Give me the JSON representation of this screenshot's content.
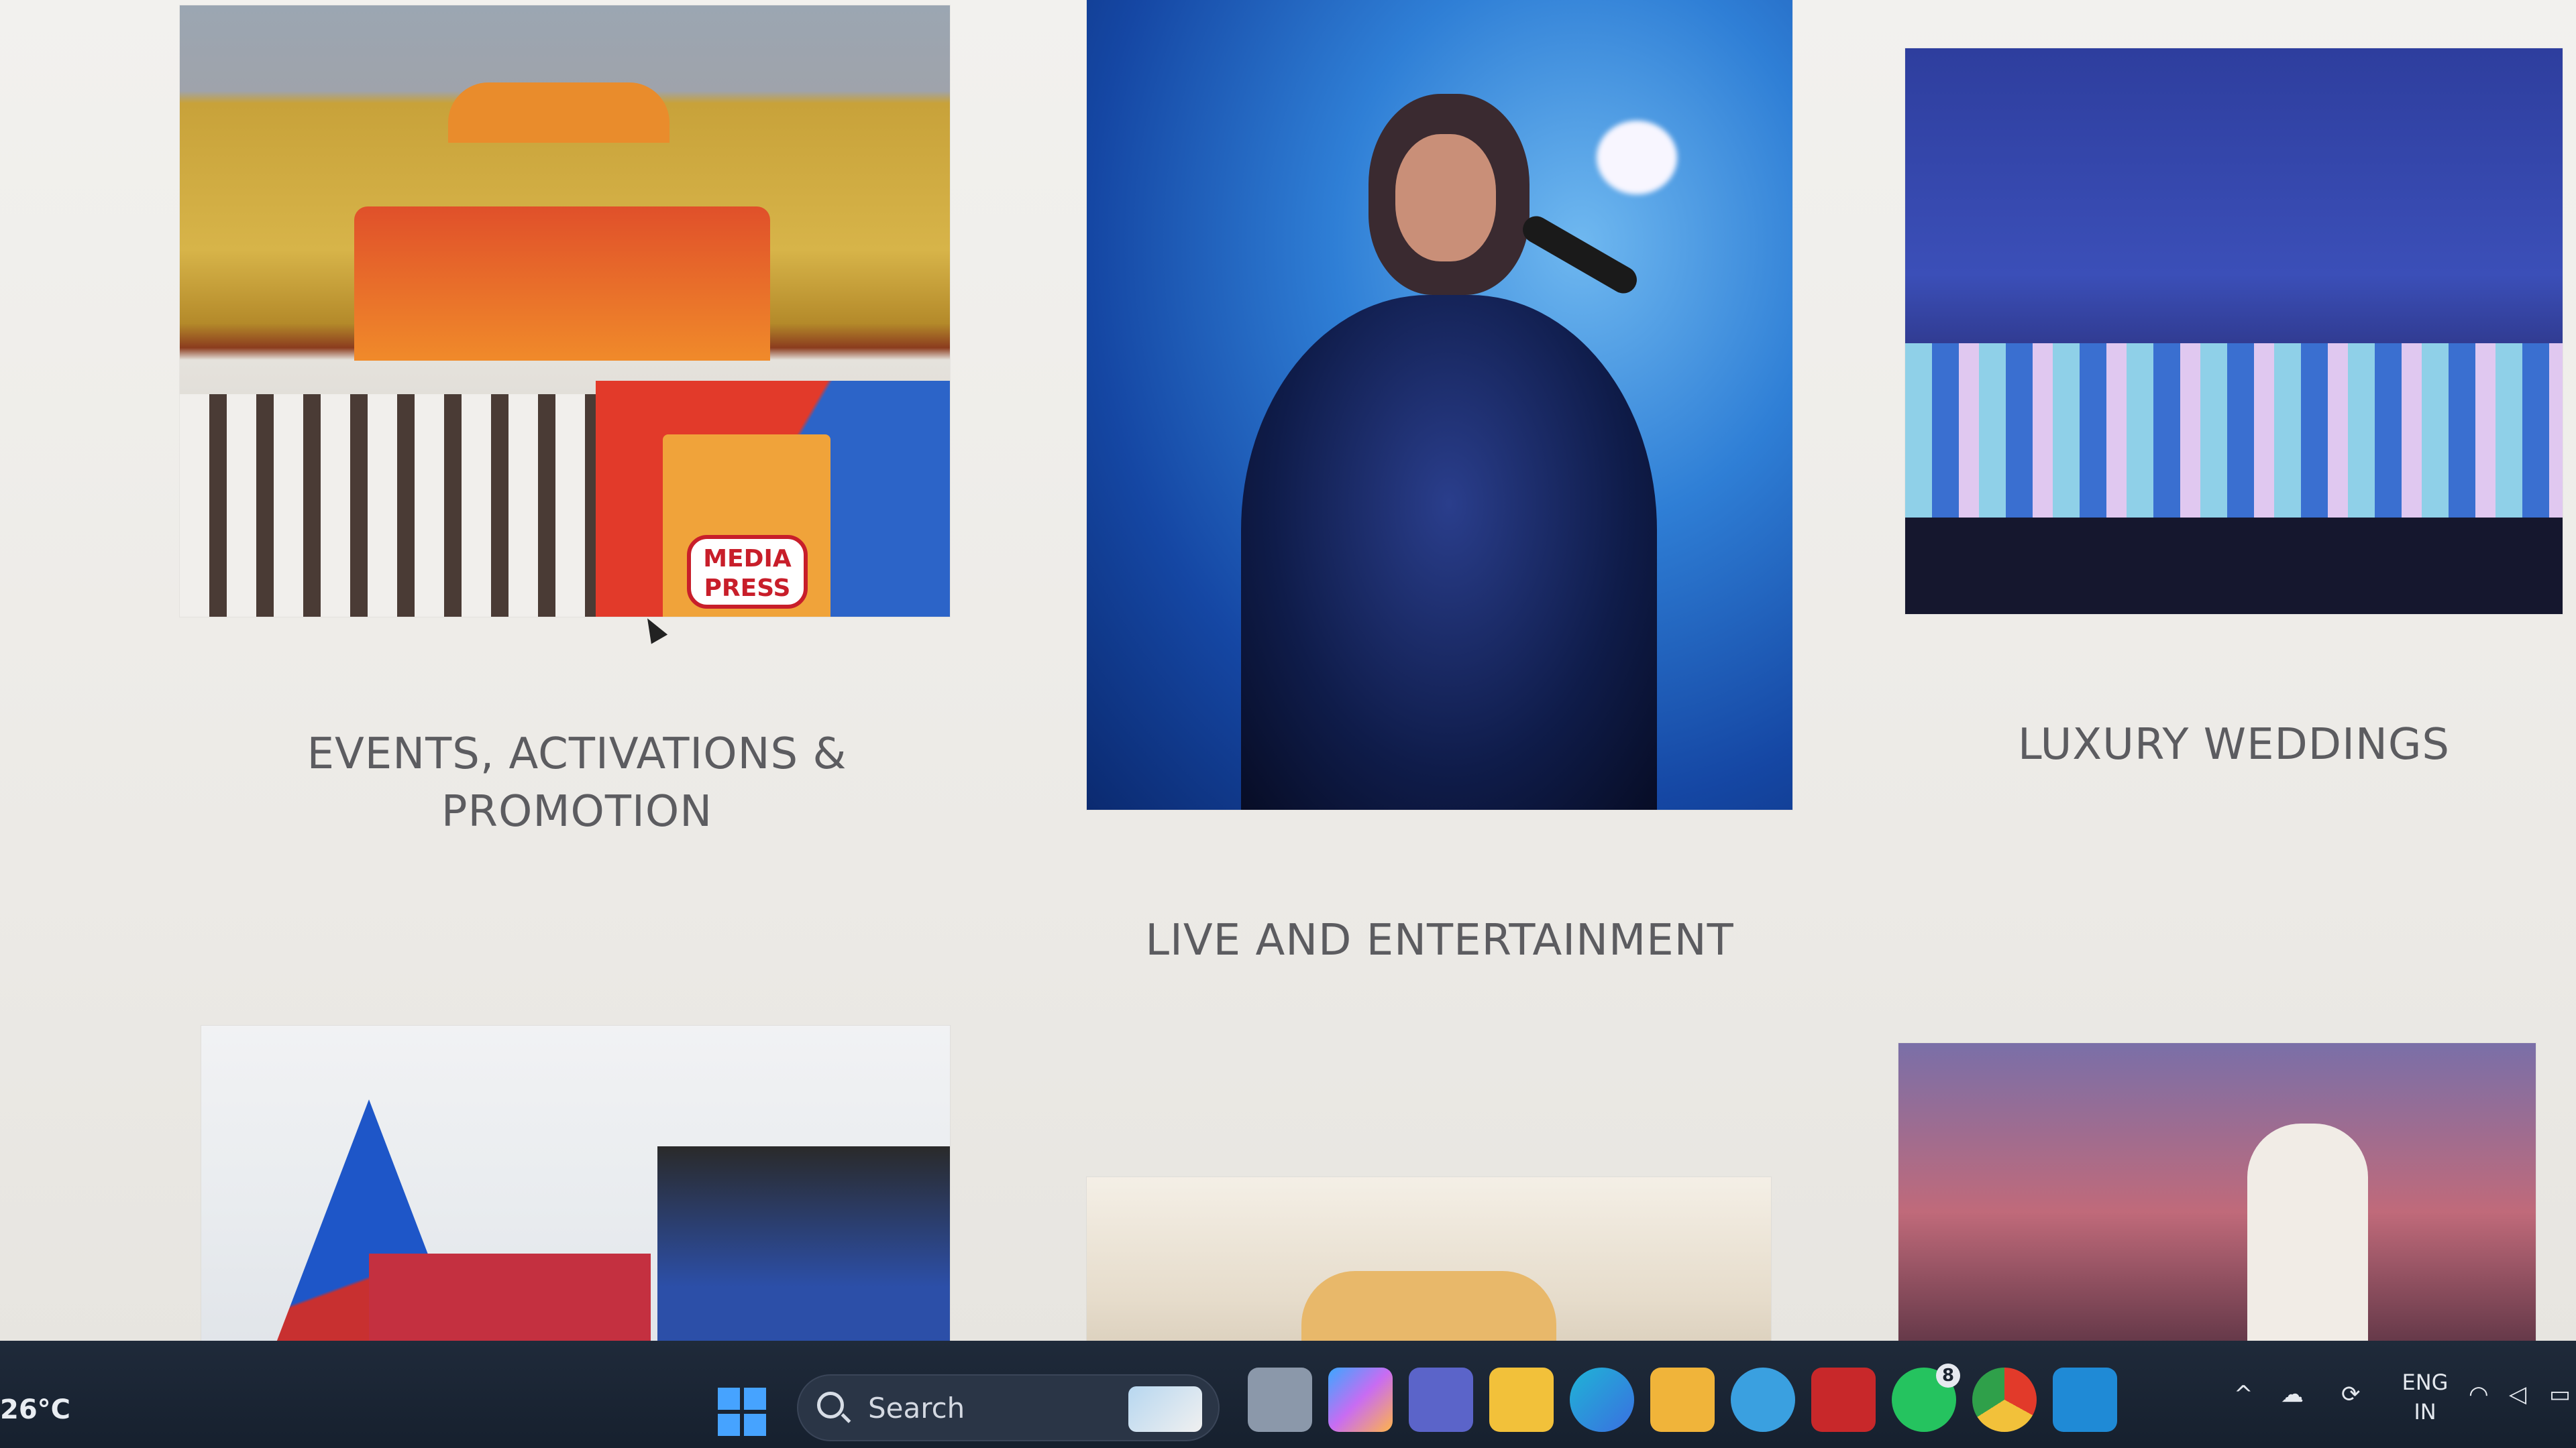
{
  "services": [
    {
      "caption_line1": "EVENTS, ACTIVATIONS &",
      "caption_line2": "PROMOTION"
    },
    {
      "caption": "LIVE AND ENTERTAINMENT"
    },
    {
      "caption": "LUXURY WEDDINGS"
    }
  ],
  "events_image": {
    "sign_text_line1": "MEDIA",
    "sign_text_line2": "PRESS"
  },
  "taskbar": {
    "weather_temp": "26°C",
    "search_label": "Search",
    "whatsapp_badge": "8",
    "language": "ENG",
    "region": "IN"
  },
  "colors": {
    "page_bg": "#ecebe8",
    "caption": "#5c5c60",
    "taskbar": "#1b2433",
    "accent_blue": "#46a3ff"
  }
}
